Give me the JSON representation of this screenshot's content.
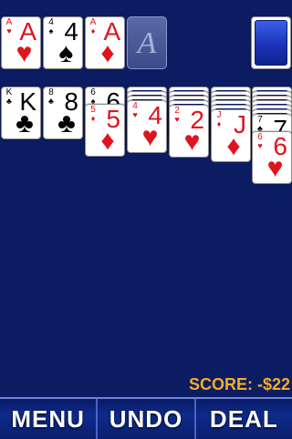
{
  "foundations": [
    {
      "rank": "A",
      "suit": "♥",
      "color": "red",
      "state": "card"
    },
    {
      "rank": "4",
      "suit": "♠",
      "color": "black",
      "state": "card"
    },
    {
      "rank": "A",
      "suit": "♦",
      "color": "red",
      "state": "card"
    },
    {
      "placeholder": "A",
      "state": "empty"
    }
  ],
  "stock": {
    "state": "facedown"
  },
  "tableau": [
    {
      "hidden": 0,
      "cards": [
        {
          "rank": "K",
          "suit": "♣",
          "color": "black"
        }
      ]
    },
    {
      "hidden": 0,
      "cards": [
        {
          "rank": "8",
          "suit": "♣",
          "color": "black"
        }
      ]
    },
    {
      "hidden": 0,
      "cards": [
        {
          "rank": "6",
          "suit": "♠",
          "color": "black"
        },
        {
          "rank": "5",
          "suit": "♦",
          "color": "red"
        }
      ]
    },
    {
      "hidden": 3,
      "cards": [
        {
          "rank": "4",
          "suit": "♥",
          "color": "red"
        }
      ]
    },
    {
      "hidden": 4,
      "cards": [
        {
          "rank": "2",
          "suit": "♥",
          "color": "red"
        }
      ]
    },
    {
      "hidden": 5,
      "cards": [
        {
          "rank": "J",
          "suit": "♦",
          "color": "red"
        }
      ]
    },
    {
      "hidden": 6,
      "cards": [
        {
          "rank": "7",
          "suit": "♣",
          "color": "black"
        },
        {
          "rank": "6",
          "suit": "♥",
          "color": "red"
        }
      ]
    }
  ],
  "score": {
    "text": "SCORE: -$22"
  },
  "toolbar": {
    "menu_label": "MENU",
    "undo_label": "UNDO",
    "deal_label": "DEAL"
  },
  "colors": {
    "felt": "#0c1c63",
    "score": "#f2ae22",
    "red_suit": "#e0141e"
  }
}
